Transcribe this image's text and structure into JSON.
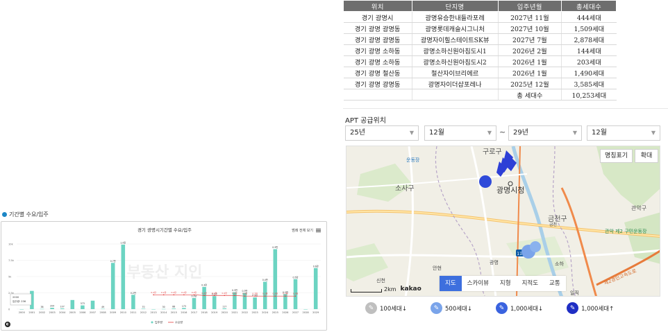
{
  "section": {
    "title": "기간별 수요/입주"
  },
  "chart_data": {
    "type": "bar",
    "title": "경기 광명시기간별 수요/입주",
    "menu_label": "범례 전체 보기",
    "watermark": "부동산 지인",
    "categories": [
      "2000",
      "2001",
      "2002",
      "2003",
      "2004",
      "2005",
      "2006",
      "2007",
      "2008",
      "2009",
      "2010",
      "2011",
      "2012",
      "2013",
      "2014",
      "2015",
      "2016",
      "2017",
      "2018",
      "2019",
      "2020",
      "2021",
      "2022",
      "2023",
      "2024",
      "2025",
      "2026",
      "2027",
      "2028",
      "2029"
    ],
    "series": [
      {
        "name": "입주량",
        "type": "bar",
        "color": "#6cd4c2",
        "values": [
          0,
          2800,
          38,
          204,
          107,
          1400,
          573,
          1300,
          49,
          7100,
          9900,
          2200,
          70,
          0,
          30,
          88,
          173,
          1700,
          3400,
          2000,
          117,
          2600,
          2500,
          1800,
          4200,
          9200,
          2300,
          4600,
          0,
          6300
        ]
      },
      {
        "name": "수요량",
        "type": "line",
        "color": "#e53b3b",
        "values": [
          null,
          null,
          null,
          null,
          null,
          null,
          null,
          null,
          null,
          null,
          null,
          null,
          null,
          2200,
          2200,
          2200,
          2200,
          2200,
          2100,
          2100,
          2100,
          2100,
          2000,
          2000,
          2000,
          2000,
          2000,
          2000,
          null,
          null
        ]
      }
    ],
    "bar_labels": [
      "",
      "",
      "38",
      "204",
      "107",
      "",
      "573",
      "",
      "49",
      "0.7만",
      "1.0만",
      "0.2만",
      "70",
      "",
      "30",
      "88",
      "173",
      "0.2만",
      "0.3만",
      "0.2만",
      "117",
      "0.3만",
      "0.3만",
      "0.2만",
      "0.4만",
      "0.9만",
      "0.2만",
      "0.5만",
      "",
      "0.6만"
    ],
    "line_labels": [
      "0.2만",
      "0.2만",
      "0.2만",
      "0.2만",
      "0.2만",
      "0.2만",
      "0.2만",
      "0.2만",
      "0.2만",
      "0.2만",
      "0.2만",
      "0.2만",
      "0.2만",
      "0.2만",
      "0.2만"
    ],
    "y_ticks": [
      "0",
      "2.5k",
      "5k",
      "7.5k",
      "10k"
    ],
    "ylim": [
      0,
      10000
    ],
    "tooltip": {
      "year": "2000",
      "label": "입주량: 236"
    },
    "legend": [
      "입주량",
      "수요량"
    ]
  },
  "table": {
    "headers": [
      "위치",
      "단지명",
      "입주년월",
      "총세대수"
    ],
    "rows": [
      [
        "경기 광명시",
        "광명유승한내들라포레",
        "2027년 11월",
        "444세대"
      ],
      [
        "경기 광명 광명동",
        "광명롯데캐슬시그니처",
        "2027년 10월",
        "1,509세대"
      ],
      [
        "경기 광명 광명동",
        "광명자이힐스테이트SK뷰",
        "2027년 7월",
        "2,878세대"
      ],
      [
        "경기 광명 소하동",
        "광명소하신원아침도시1",
        "2026년 2월",
        "144세대"
      ],
      [
        "경기 광명 소하동",
        "광명소하신원아침도시2",
        "2026년 1월",
        "203세대"
      ],
      [
        "경기 광명 철산동",
        "철산자이브리에르",
        "2026년 1월",
        "1,490세대"
      ],
      [
        "경기 광명 광명동",
        "광명자이더샵포레나",
        "2025년 12월",
        "3,585세대"
      ]
    ],
    "total_label": "총 세대수",
    "total_value": "10,253세대"
  },
  "apt": {
    "title": "APT 공급위치",
    "from_year": "25년",
    "from_month": "12월",
    "tilde": "~",
    "to_year": "29년",
    "to_month": "12월"
  },
  "map": {
    "name_toggle": "명칭표기",
    "zoom": "확대",
    "labels": {
      "guro": "구로구",
      "sosa": "소사구",
      "city_hall": "광명시청",
      "geumcheon": "금천구",
      "gwanak": "관악구",
      "stadium": "관악 제2 구민운동장",
      "bupyeong": "운동장",
      "ilick": "일직",
      "soha": "소하",
      "gwangmyeong": "광명",
      "anhyeon": "안현",
      "sinchon": "신천",
      "geumcheon_ic": "금천",
      "seoul_ring": "제2경인고속도로",
      "route": "110"
    },
    "tabs": [
      "지도",
      "스카이뷰",
      "지형",
      "지적도",
      "교통"
    ],
    "active_tab": "지도",
    "scale": "2km",
    "brand": "kakao",
    "legend": [
      "100세대↓",
      "500세대↓",
      "1,000세대↓",
      "1,000세대↑"
    ]
  }
}
